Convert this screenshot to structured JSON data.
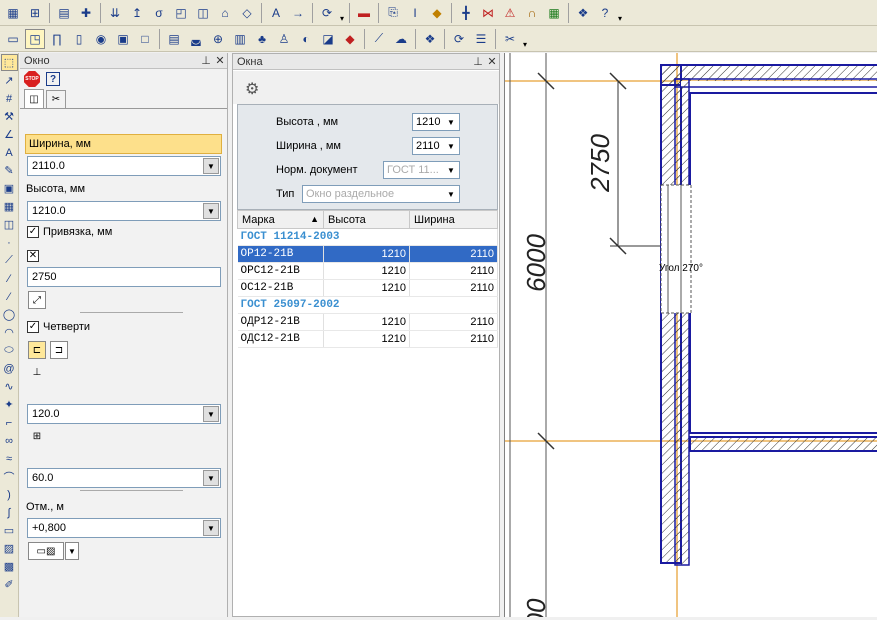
{
  "toolbar1": {
    "icons": [
      "wall-hatch-icon",
      "column-icon",
      "grid-icon",
      "add-icon",
      "stair-icon",
      "slab-icon",
      "node-icon",
      "window-icon",
      "door-icon",
      "room-icon",
      "level-icon",
      "text-icon",
      "arrow-icon",
      "refresh-icon",
      "catalog-icon",
      "copy-icon",
      "beam-icon",
      "paint-icon",
      "pipe-icon",
      "valve-icon",
      "warning-icon",
      "arc-icon",
      "table-icon",
      "module-icon",
      "help-icon"
    ]
  },
  "toolbar2": {
    "icons": [
      "box-icon",
      "window-insert-icon",
      "door-insert-icon",
      "opening-icon",
      "sphere-icon",
      "frame-icon",
      "rect-icon",
      "layers-icon",
      "bathtub-icon",
      "globe-icon",
      "cabinet-icon",
      "plant-icon",
      "person-icon",
      "shapes-icon",
      "shape-icon",
      "eraser-icon",
      "ruler-icon",
      "cloud-icon",
      "module-icon",
      "refresh-icon",
      "list-icon",
      "tools-icon"
    ]
  },
  "panel1": {
    "title": "Окно",
    "width_label": "Ширина, мм",
    "width_value": "2110.0",
    "height_label": "Высота, мм",
    "height_value": "1210.0",
    "binding_label": "Привязка, мм",
    "binding_value": "2750",
    "quarters_label": "Четверти",
    "value_120": "120.0",
    "value_60": "60.0",
    "elevation_label": "Отм., м",
    "elevation_value": "+0,800"
  },
  "panel2": {
    "title": "Окна",
    "height_label": "Высота , мм",
    "height_value": "1210",
    "width_label": "Ширина , мм",
    "width_value": "2110",
    "normdoc_label": "Норм. документ",
    "normdoc_value": "ГОСТ 11...",
    "type_label": "Тип",
    "type_value": "Окно раздельное",
    "columns": [
      "Марка",
      "Высота",
      "Ширина"
    ],
    "groups": [
      {
        "name": "ГОСТ 11214-2003",
        "rows": [
          {
            "mark": "ОР12-21В",
            "h": "1210",
            "w": "2110",
            "selected": true
          },
          {
            "mark": "ОРС12-21В",
            "h": "1210",
            "w": "2110",
            "selected": false
          },
          {
            "mark": "ОС12-21В",
            "h": "1210",
            "w": "2110",
            "selected": false
          }
        ]
      },
      {
        "name": "ГОСТ 25097-2002",
        "rows": [
          {
            "mark": "ОДР12-21В",
            "h": "1210",
            "w": "2110",
            "selected": false
          },
          {
            "mark": "ОДС12-21В",
            "h": "1210",
            "w": "2110",
            "selected": false
          }
        ]
      }
    ]
  },
  "drawing": {
    "dim_2750": "2750",
    "dim_6000": "6000",
    "dim_bottom": "00",
    "angle_label": "Угол 270°"
  },
  "colors": {
    "wall": "#1a1aa0",
    "axis": "#e08a00",
    "selection": "#316ac5",
    "highlight": "#fde08b"
  }
}
